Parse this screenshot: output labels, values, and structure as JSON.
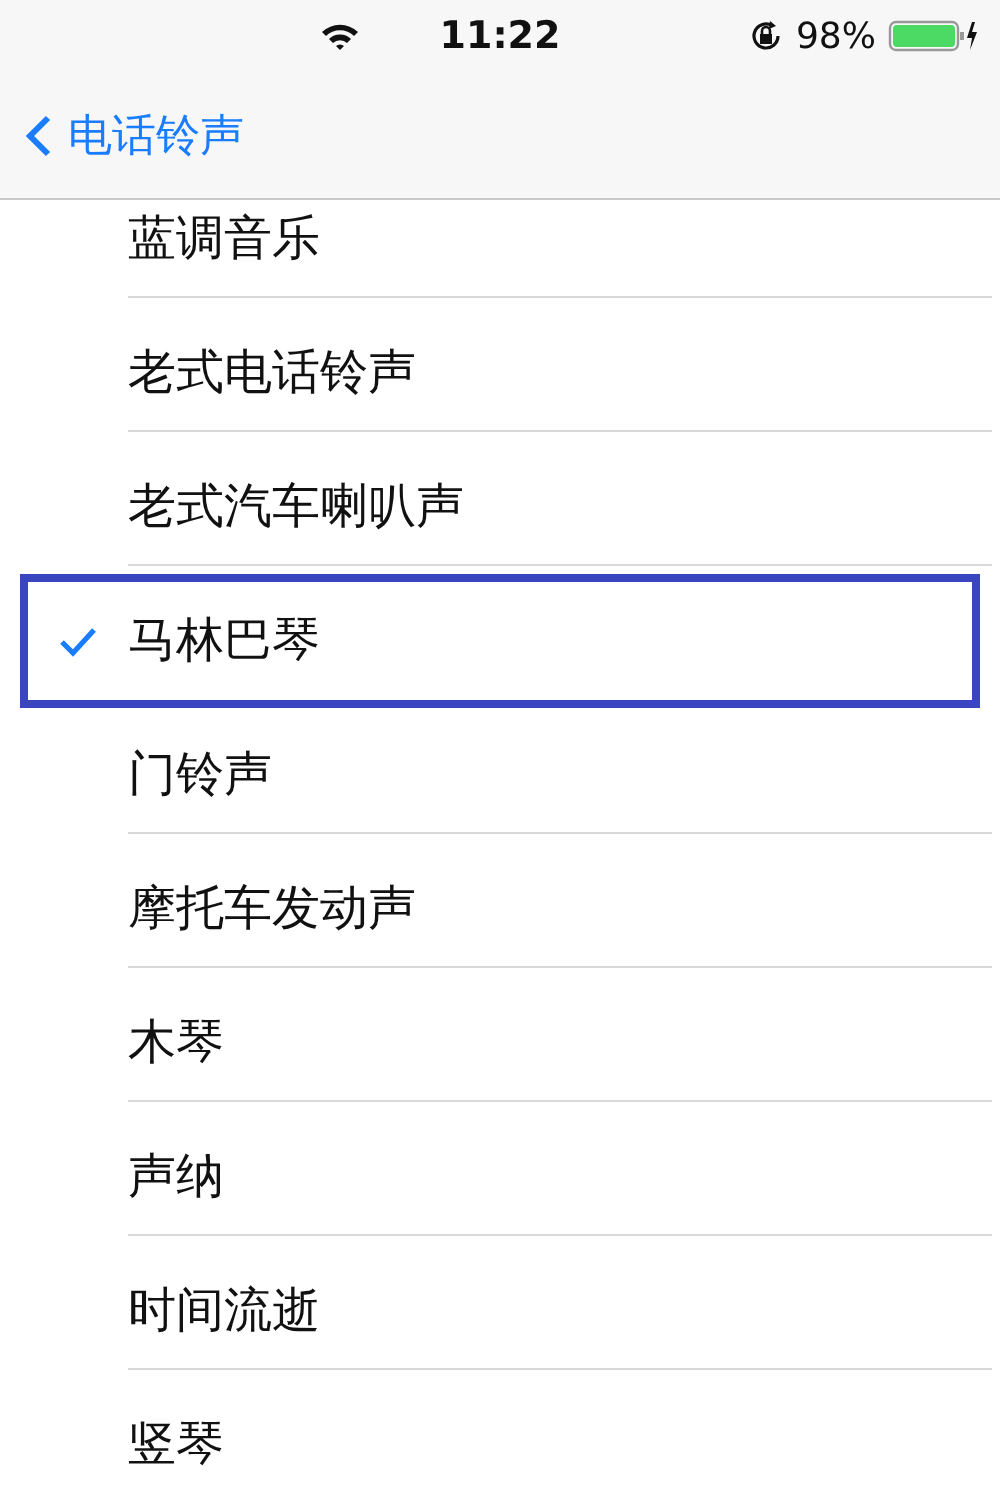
{
  "status_bar": {
    "time": "11:22",
    "battery": "98%"
  },
  "nav": {
    "back": "电话铃声"
  },
  "rows": [
    {
      "label": "蓝调音乐",
      "selected": false
    },
    {
      "label": "老式电话铃声",
      "selected": false
    },
    {
      "label": "老式汽车喇叭声",
      "selected": false
    },
    {
      "label": "马林巴琴",
      "selected": true
    },
    {
      "label": "门铃声",
      "selected": false
    },
    {
      "label": "摩托车发动声",
      "selected": false
    },
    {
      "label": "木琴",
      "selected": false
    },
    {
      "label": "声纳",
      "selected": false
    },
    {
      "label": "时间流逝",
      "selected": false
    },
    {
      "label": "竖琴",
      "selected": false
    }
  ]
}
